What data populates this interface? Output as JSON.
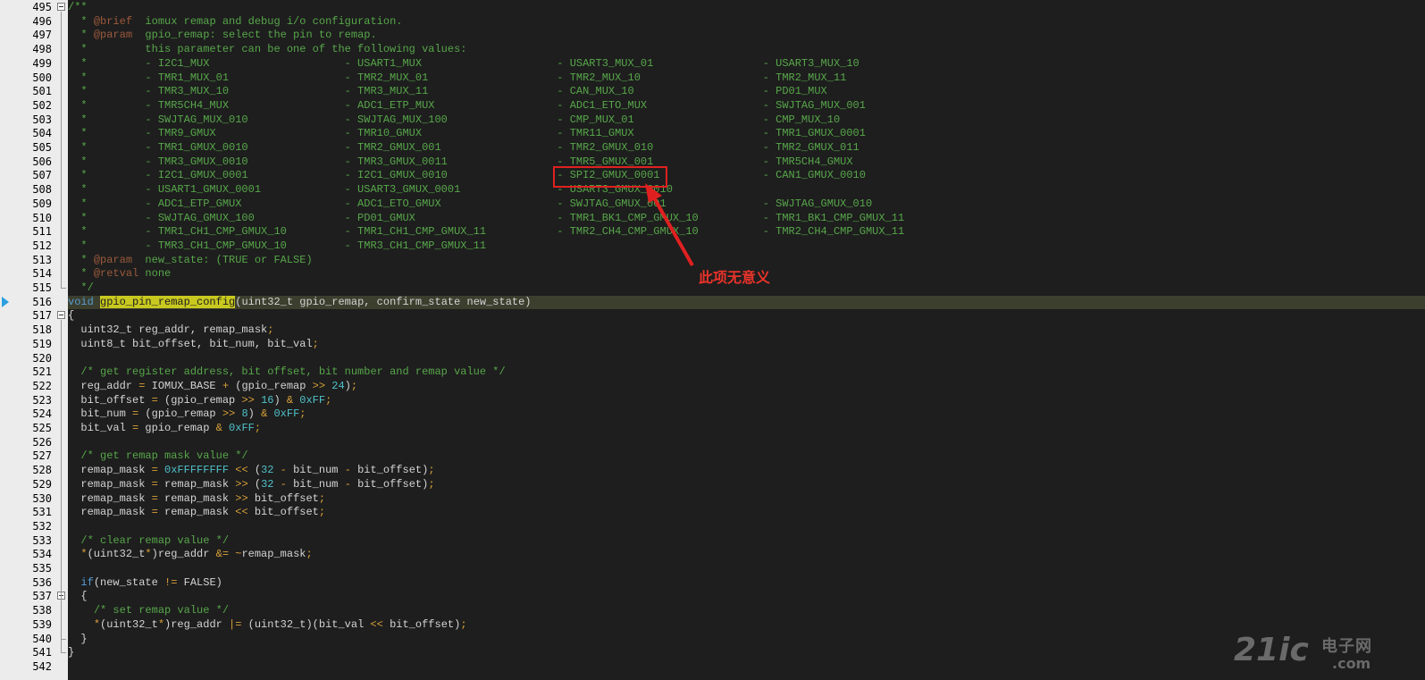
{
  "editor": {
    "first_line_number": 495,
    "current_line": 516,
    "lines": [
      "/**",
      "  * @brief  iomux remap and debug i/o configuration.",
      "  * @param  gpio_remap: select the pin to remap.",
      "  *         this parameter can be one of the following values:",
      "  *         - I2C1_MUX                     - USART1_MUX                     - USART3_MUX_01                 - USART3_MUX_10",
      "  *         - TMR1_MUX_01                  - TMR2_MUX_01                    - TMR2_MUX_10                   - TMR2_MUX_11",
      "  *         - TMR3_MUX_10                  - TMR3_MUX_11                    - CAN_MUX_10                    - PD01_MUX",
      "  *         - TMR5CH4_MUX                  - ADC1_ETP_MUX                   - ADC1_ETO_MUX                  - SWJTAG_MUX_001",
      "  *         - SWJTAG_MUX_010               - SWJTAG_MUX_100                 - CMP_MUX_01                    - CMP_MUX_10",
      "  *         - TMR9_GMUX                    - TMR10_GMUX                     - TMR11_GMUX                    - TMR1_GMUX_0001",
      "  *         - TMR1_GMUX_0010               - TMR2_GMUX_001                  - TMR2_GMUX_010                 - TMR2_GMUX_011",
      "  *         - TMR3_GMUX_0010               - TMR3_GMUX_0011                 - TMR5_GMUX_001                 - TMR5CH4_GMUX",
      "  *         - I2C1_GMUX_0001               - I2C1_GMUX_0010                 - SPI2_GMUX_0001                - CAN1_GMUX_0010",
      "  *         - USART1_GMUX_0001             - USART3_GMUX_0001               - USART3_GMUX_0010",
      "  *         - ADC1_ETP_GMUX                - ADC1_ETO_GMUX                  - SWJTAG_GMUX_001               - SWJTAG_GMUX_010",
      "  *         - SWJTAG_GMUX_100              - PD01_GMUX                      - TMR1_BK1_CMP_GMUX_10          - TMR1_BK1_CMP_GMUX_11",
      "  *         - TMR1_CH1_CMP_GMUX_10         - TMR1_CH1_CMP_GMUX_11           - TMR2_CH4_CMP_GMUX_10          - TMR2_CH4_CMP_GMUX_11",
      "  *         - TMR3_CH1_CMP_GMUX_10         - TMR3_CH1_CMP_GMUX_11",
      "  * @param  new_state: (TRUE or FALSE)",
      "  * @retval none",
      "  */",
      "void gpio_pin_remap_config(uint32_t gpio_remap, confirm_state new_state)",
      "{",
      "  uint32_t reg_addr, remap_mask;",
      "  uint8_t bit_offset, bit_num, bit_val;",
      "",
      "  /* get register address, bit offset, bit number and remap value */",
      "  reg_addr = IOMUX_BASE + (gpio_remap >> 24);",
      "  bit_offset = (gpio_remap >> 16) & 0xFF;",
      "  bit_num = (gpio_remap >> 8) & 0xFF;",
      "  bit_val = gpio_remap & 0xFF;",
      "",
      "  /* get remap mask value */",
      "  remap_mask = 0xFFFFFFFF << (32 - bit_num - bit_offset);",
      "  remap_mask = remap_mask >> (32 - bit_num - bit_offset);",
      "  remap_mask = remap_mask >> bit_offset;",
      "  remap_mask = remap_mask << bit_offset;",
      "",
      "  /* clear remap value */",
      "  *(uint32_t*)reg_addr &= ~remap_mask;",
      "",
      "  if(new_state != FALSE)",
      "  {",
      "    /* set remap value */",
      "    *(uint32_t*)reg_addr |= (uint32_t)(bit_val << bit_offset);",
      "  }",
      "}",
      ""
    ]
  },
  "annotation": {
    "text": "此项无意义",
    "highlighted_item": "- SPI2_GMUX_0001",
    "color": "#e8332a"
  },
  "watermark": {
    "brand": "21ic",
    "cn": "电子网",
    "domain": ".com"
  },
  "colors": {
    "background": "#1e1e1e",
    "comment": "#57a64a",
    "keyword": "#569cd6",
    "number": "#4fc1c9",
    "operator": "#d7a038"
  }
}
